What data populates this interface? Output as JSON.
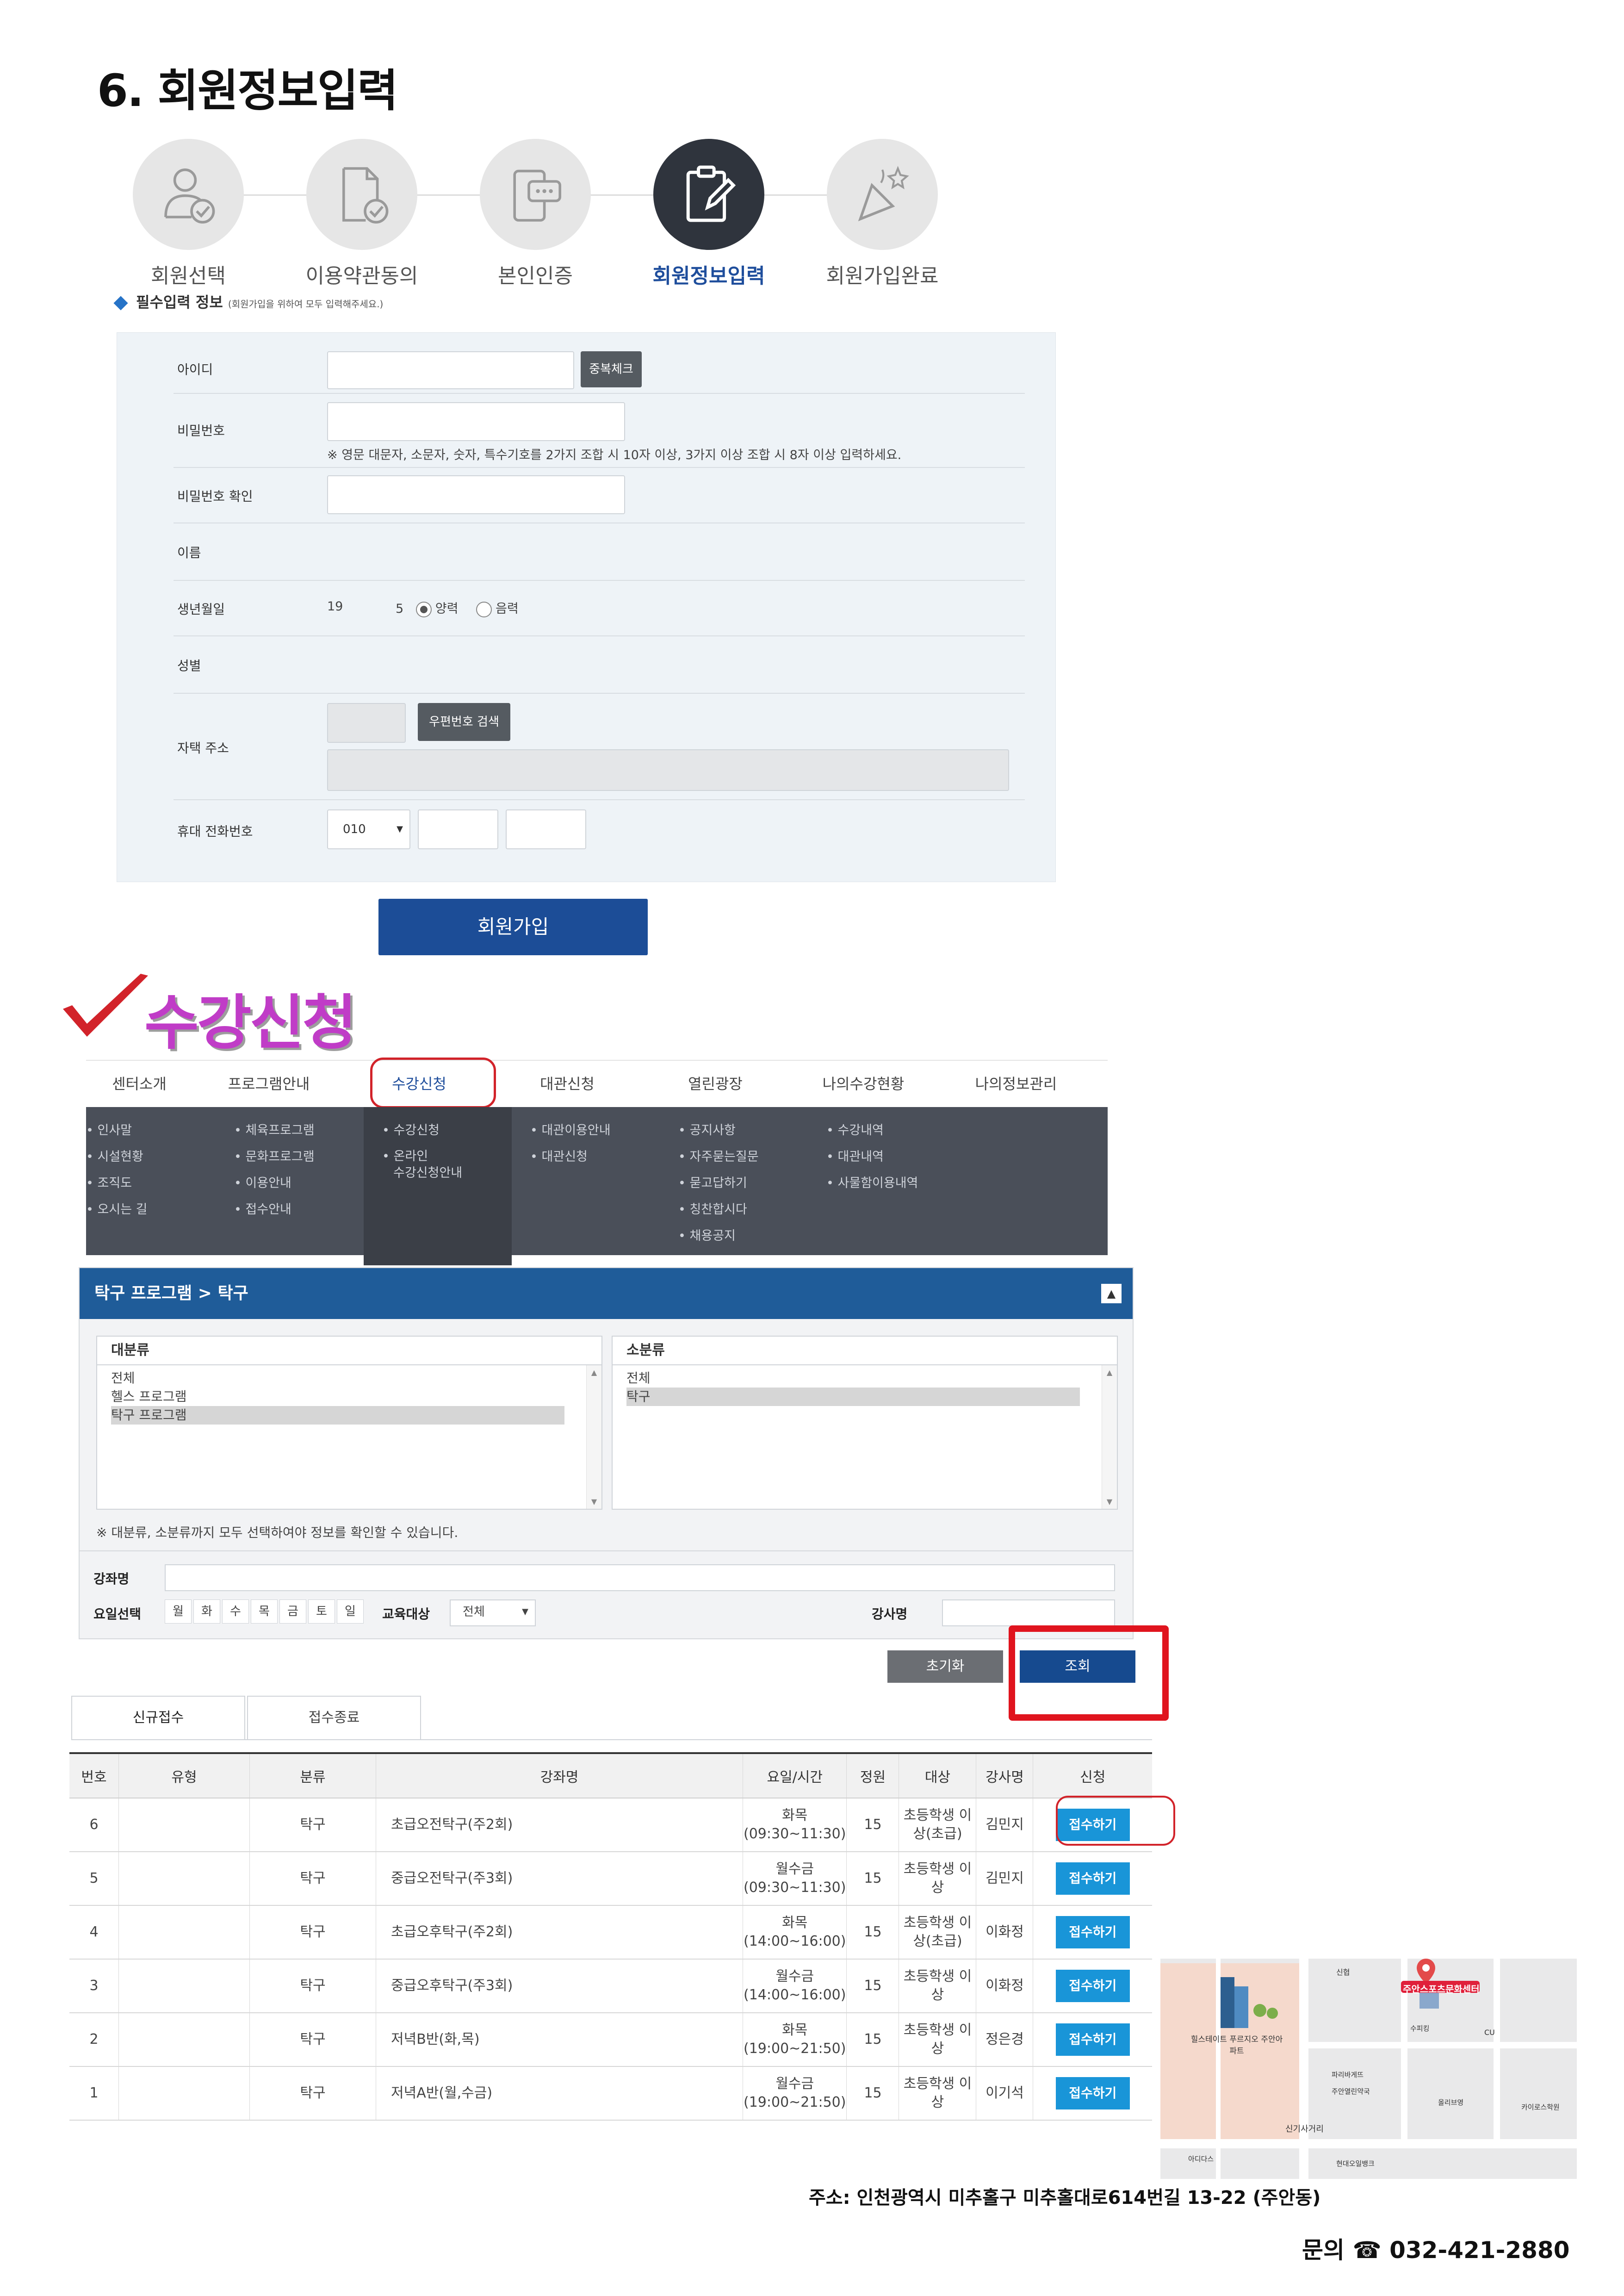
{
  "section_title": "6. 회원정보입력",
  "steps": [
    {
      "label": "회원선택",
      "icon": "user-check-icon",
      "active": false
    },
    {
      "label": "이용약관동의",
      "icon": "document-check-icon",
      "active": false
    },
    {
      "label": "본인인증",
      "icon": "phone-chat-icon",
      "active": false
    },
    {
      "label": "회원정보입력",
      "icon": "clipboard-edit-icon",
      "active": true
    },
    {
      "label": "회원가입완료",
      "icon": "party-popper-icon",
      "active": false
    }
  ],
  "required": {
    "title": "필수입력 정보",
    "note": "(회원가입을 위하여 모두 입력해주세요.)"
  },
  "form": {
    "id_label": "아이디",
    "dup_check": "중복체크",
    "pw_label": "비밀번호",
    "pw_hint": "※ 영문 대문자, 소문자, 숫자, 특수기호를 2가지 조합 시 10자 이상, 3가지 이상 조합 시 8자 이상 입력하세요.",
    "pw_confirm_label": "비밀번호 확인",
    "name_label": "이름",
    "birth_label": "생년월일",
    "birth_year": "19",
    "birth_day": "5",
    "solar": "양력",
    "lunar": "음력",
    "gender_label": "성별",
    "address_label": "자택 주소",
    "zip_search": "우편번호 검색",
    "phone_label": "휴대 전화번호",
    "phone_prefix": "010"
  },
  "join_button": "회원가입",
  "apply_title": "수강신청",
  "gnb": [
    "센터소개",
    "프로그램안내",
    "수강신청",
    "대관신청",
    "열린광장",
    "나의수강현황",
    "나의정보관리"
  ],
  "mega_menu": [
    [
      "• 인사말",
      "• 시설현황",
      "• 조직도",
      "• 오시는 길"
    ],
    [
      "• 체육프로그램",
      "• 문화프로그램",
      "• 이용안내",
      "• 접수안내"
    ],
    [
      "• 수강신청",
      "• 온라인",
      "수강신청안내"
    ],
    [
      "• 대관이용안내",
      "• 대관신청"
    ],
    [
      "• 공지사항",
      "• 자주묻는질문",
      "• 묻고답하기",
      "• 칭찬합시다",
      "• 채용공지"
    ],
    [
      "• 수강내역",
      "• 대관내역",
      "• 사물함이용내역"
    ]
  ],
  "panel": {
    "title": "탁구 프로그램 > 탁구",
    "toggle": "▲",
    "category_label": "대분류",
    "categories": [
      "전체",
      "헬스 프로그램",
      "탁구 프로그램"
    ],
    "subcategory_label": "소분류",
    "subcategories": [
      "전체",
      "탁구"
    ],
    "note": "※ 대분류, 소분류까지 모두 선택하여야 정보를 확인할 수 있습니다.",
    "course_label": "강좌명",
    "day_label": "요일선택",
    "days": [
      "월",
      "화",
      "수",
      "목",
      "금",
      "토",
      "일"
    ],
    "target_label": "교육대상",
    "target_value": "전체",
    "instructor_label": "강사명"
  },
  "buttons": {
    "reset": "초기화",
    "search": "조회"
  },
  "tabs": [
    "신규접수",
    "접수종료"
  ],
  "table": {
    "headers": [
      "번호",
      "유형",
      "분류",
      "강좌명",
      "요일/시간",
      "정원",
      "대상",
      "강사명",
      "신청"
    ],
    "rows": [
      {
        "no": "6",
        "type": "",
        "cat": "탁구",
        "name": "초급오전탁구(주2회)",
        "day": "화목",
        "time": "(09:30~11:30)",
        "cap": "15",
        "t1": "초등학생 이",
        "t2": "상(초급)",
        "inst": "김민지",
        "btn": "접수하기"
      },
      {
        "no": "5",
        "type": "",
        "cat": "탁구",
        "name": "중급오전탁구(주3회)",
        "day": "월수금",
        "time": "(09:30~11:30)",
        "cap": "15",
        "t1": "초등학생 이",
        "t2": "상",
        "inst": "김민지",
        "btn": "접수하기"
      },
      {
        "no": "4",
        "type": "",
        "cat": "탁구",
        "name": "초급오후탁구(주2회)",
        "day": "화목",
        "time": "(14:00~16:00)",
        "cap": "15",
        "t1": "초등학생 이",
        "t2": "상(초급)",
        "inst": "이화정",
        "btn": "접수하기"
      },
      {
        "no": "3",
        "type": "",
        "cat": "탁구",
        "name": "중급오후탁구(주3회)",
        "day": "월수금",
        "time": "(14:00~16:00)",
        "cap": "15",
        "t1": "초등학생 이",
        "t2": "상",
        "inst": "이화정",
        "btn": "접수하기"
      },
      {
        "no": "2",
        "type": "",
        "cat": "탁구",
        "name": "저녁B반(화,목)",
        "day": "화목",
        "time": "(19:00~21:50)",
        "cap": "15",
        "t1": "초등학생 이",
        "t2": "상",
        "inst": "정은경",
        "btn": "접수하기"
      },
      {
        "no": "1",
        "type": "",
        "cat": "탁구",
        "name": "저녁A반(월,수금)",
        "day": "월수금",
        "time": "(19:00~21:50)",
        "cap": "15",
        "t1": "초등학생 이",
        "t2": "상",
        "inst": "이기석",
        "btn": "접수하기"
      }
    ]
  },
  "map": {
    "labels": {
      "center": "주안스포츠문화센터",
      "apt": "힐스테이트 푸르지오 주안아파트",
      "crossroad": "신기사거리",
      "cu": "CU",
      "shinhyup": "신협",
      "adidas": "아디다스",
      "hyundai": "현대오일뱅크",
      "pharmacy": "주안열린약국",
      "paris": "파리바게뜨",
      "olive": "올리브영",
      "suphim": "수피킹",
      "kairos": "카이로스학원"
    }
  },
  "address": "주소: 인천광역시 미추홀구 미추홀대로614번길 13-22 (주안동)",
  "contact": "문의 ☎ 032-421-2880",
  "colors": {
    "primary": "#1c4d97",
    "panel_header": "#1f5c99",
    "apply_button": "#1995d8",
    "highlight": "#d2232a",
    "title_purple": "#c03cc7"
  }
}
